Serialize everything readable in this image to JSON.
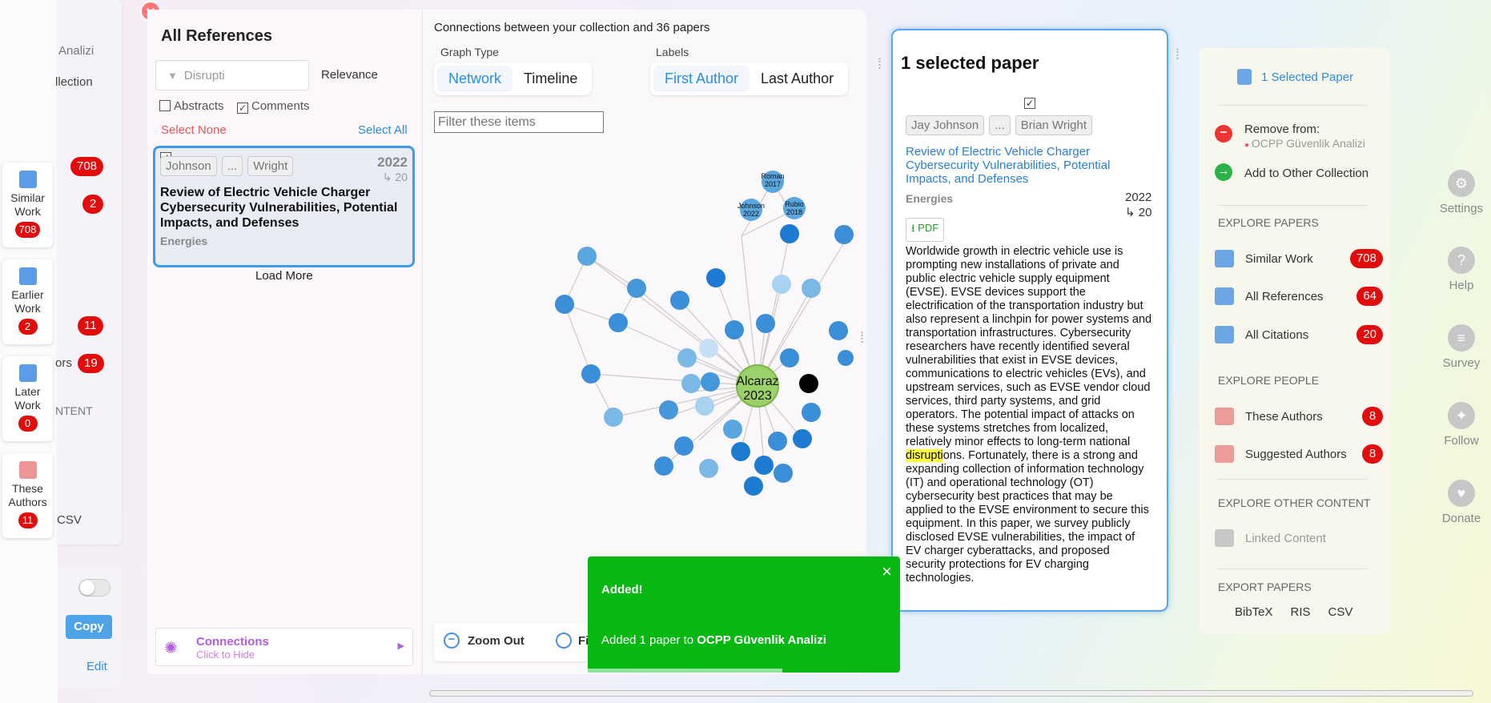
{
  "left_strip": {
    "items": [
      {
        "label": "Similar Work",
        "count": "708",
        "icon": "document-icon"
      },
      {
        "label": "Earlier Work",
        "count": "2",
        "icon": "documents-stack-icon"
      },
      {
        "label": "Later Work",
        "count": "0",
        "icon": "documents-stack-icon"
      },
      {
        "label": "These Authors",
        "count": "11",
        "icon": "people-icon"
      }
    ]
  },
  "behind_panel": {
    "t1": "Analizi",
    "t2": "llection",
    "b1": "708",
    "b2": "2",
    "b3": "11",
    "t3": "ors",
    "b4": "19",
    "t4": "NTENT",
    "t5": "CSV",
    "copy": "Copy",
    "edit": "Edit"
  },
  "refs": {
    "title": "All References",
    "filter_value": "Disrupti",
    "sort": "Relevance",
    "abstracts_label": "Abstracts",
    "comments_label": "Comments",
    "select_none": "Select None",
    "select_all": "Select All",
    "paper": {
      "author_first": "Johnson",
      "ellipsis": "...",
      "author_last": "Wright",
      "year": "2022",
      "citations": "↳ 20",
      "title": "Review of Electric Vehicle Charger Cybersecurity Vulnerabilities, Potential Impacts, and Defenses",
      "journal": "Energies"
    },
    "load_more": "Load More",
    "connections_title": "Connections",
    "connections_sub": "Click to Hide"
  },
  "graph": {
    "header": "Connections between your collection and 36 papers",
    "graph_type_label": "Graph Type",
    "network": "Network",
    "timeline": "Timeline",
    "labels_label": "Labels",
    "first_author": "First Author",
    "last_author": "Last Author",
    "filter_placeholder": "Filter these items",
    "center_label_1": "Alcaraz",
    "center_label_2": "2023",
    "n1": "Roman",
    "n1y": "2017",
    "n2": "Johnson",
    "n2y": "2022",
    "n3": "Rubio",
    "n3y": "2018",
    "zoom_out": "Zoom Out",
    "fit": "Fi"
  },
  "toast": {
    "title": "Added!",
    "msg_prefix": "Added 1 paper to ",
    "msg_collection": "OCPP Güvenlik Analizi"
  },
  "selected": {
    "heading": "1 selected paper",
    "author_first": "Jay Johnson",
    "ellipsis": "...",
    "author_last": "Brian Wright",
    "title": "Review of Electric Vehicle Charger Cybersecurity Vulnerabilities, Potential Impacts, and Defenses",
    "journal": "Energies",
    "year": "2022",
    "citations": "↳ 20",
    "pdf": "⭳ PDF",
    "abstract_before": "Worldwide growth in electric vehicle use is prompting new installations of private and public electric vehicle supply equipment (EVSE). EVSE devices support the electrification of the transportation industry but also represent a linchpin for power systems and transportation infrastructures. Cybersecurity researchers have recently identified several vulnerabilities that exist in EVSE devices, communications to electric vehicles (EVs), and upstream services, such as EVSE vendor cloud services, third party systems, and grid operators. The potential impact of attacks on these systems stretches from localized, relatively minor effects to long-term national ",
    "abstract_highlight": "disrupti",
    "abstract_after": "ons. Fortunately, there is a strong and expanding collection of information technology (IT) and operational technology (OT) cybersecurity best practices that may be applied to the EVSE environment to secure this equipment. In this paper, we survey publicly disclosed EVSE vulnerabilities, the impact of EV charger cyberattacks, and proposed security protections for EV charging technologies."
  },
  "right_panel": {
    "selected_paper": "1 Selected Paper",
    "remove_from": "Remove from:",
    "collection": "OCPP Güvenlik Analizi",
    "add_other": "Add to Other Collection",
    "explore_papers": "EXPLORE PAPERS",
    "similar_work": "Similar Work",
    "similar_count": "708",
    "all_references": "All References",
    "references_count": "64",
    "all_citations": "All Citations",
    "citations_count": "20",
    "explore_people": "EXPLORE PEOPLE",
    "these_authors": "These Authors",
    "authors_count": "8",
    "suggested_authors": "Suggested Authors",
    "suggested_count": "8",
    "explore_other": "EXPLORE OTHER CONTENT",
    "linked_content": "Linked Content",
    "export_papers": "EXPORT PAPERS",
    "bibtex": "BibTeX",
    "ris": "RIS",
    "csv": "CSV"
  },
  "right_nav": {
    "settings": "Settings",
    "help": "Help",
    "survey": "Survey",
    "follow": "Follow",
    "donate": "Donate"
  },
  "colors": {
    "accent": "#2a8ee0",
    "badge": "#e30b0b",
    "toast": "#08b812",
    "highlight": "#ffff33"
  }
}
